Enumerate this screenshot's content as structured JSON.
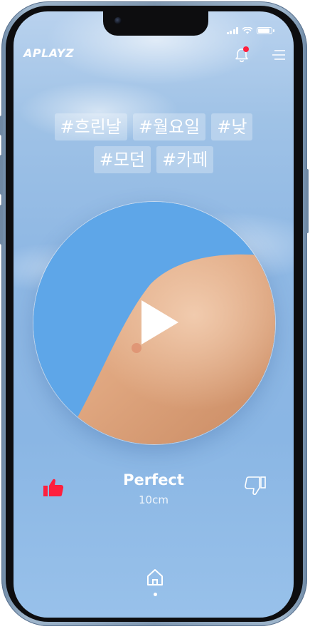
{
  "header": {
    "logo_text": "APLAYZ",
    "bell_icon": "bell-icon",
    "menu_icon": "hamburger-menu-icon",
    "notification_dot_color": "#ff1f3d"
  },
  "tags": [
    "#흐린날",
    "#월요일",
    "#낮",
    "#모던",
    "#카페"
  ],
  "player": {
    "play_icon": "play-icon",
    "track_title": "Perfect",
    "track_artist": "10cm",
    "like_icon": "thumbs-up-icon",
    "like_color": "#ff1f3d",
    "dislike_icon": "thumbs-down-icon"
  },
  "nav": {
    "home_icon": "home-icon"
  }
}
